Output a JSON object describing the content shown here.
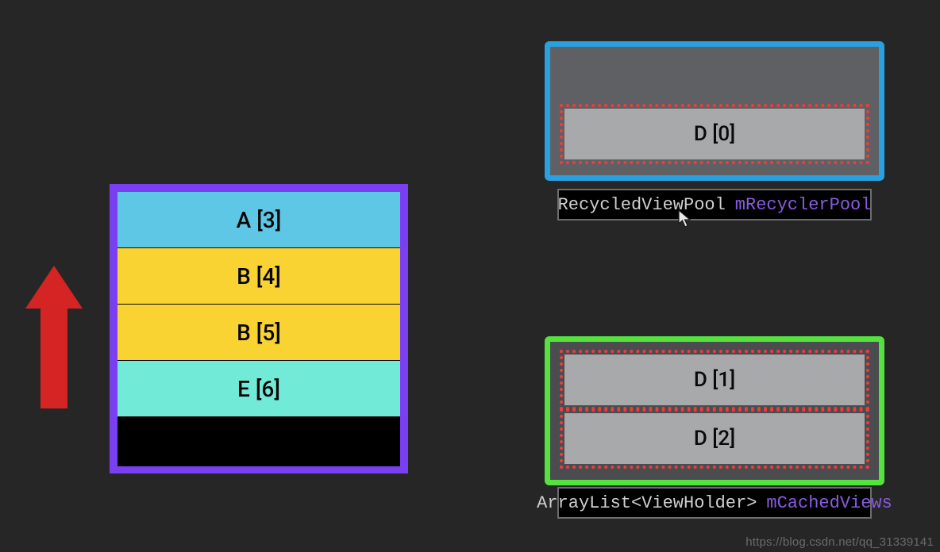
{
  "viewport": {
    "rows": [
      "A [3]",
      "B [4]",
      "B [5]",
      "E [6]"
    ]
  },
  "recyclerPool": {
    "items": [
      "D [0]"
    ],
    "caption_type": "RecycledViewPool",
    "caption_var": "mRecyclerPool"
  },
  "cachedViews": {
    "items": [
      "D [1]",
      "D [2]"
    ],
    "caption_type": "ArrayList<ViewHolder>",
    "caption_var": "mCachedViews"
  },
  "watermark": "https://blog.csdn.net/qq_31339141",
  "colors": {
    "arrow": "#d42424",
    "viewport_border": "#7b3ff2",
    "recycler_border": "#2aa0e0",
    "cached_border": "#55e23e",
    "dot": "#ef3d3d",
    "var_name": "#8a5adf"
  }
}
